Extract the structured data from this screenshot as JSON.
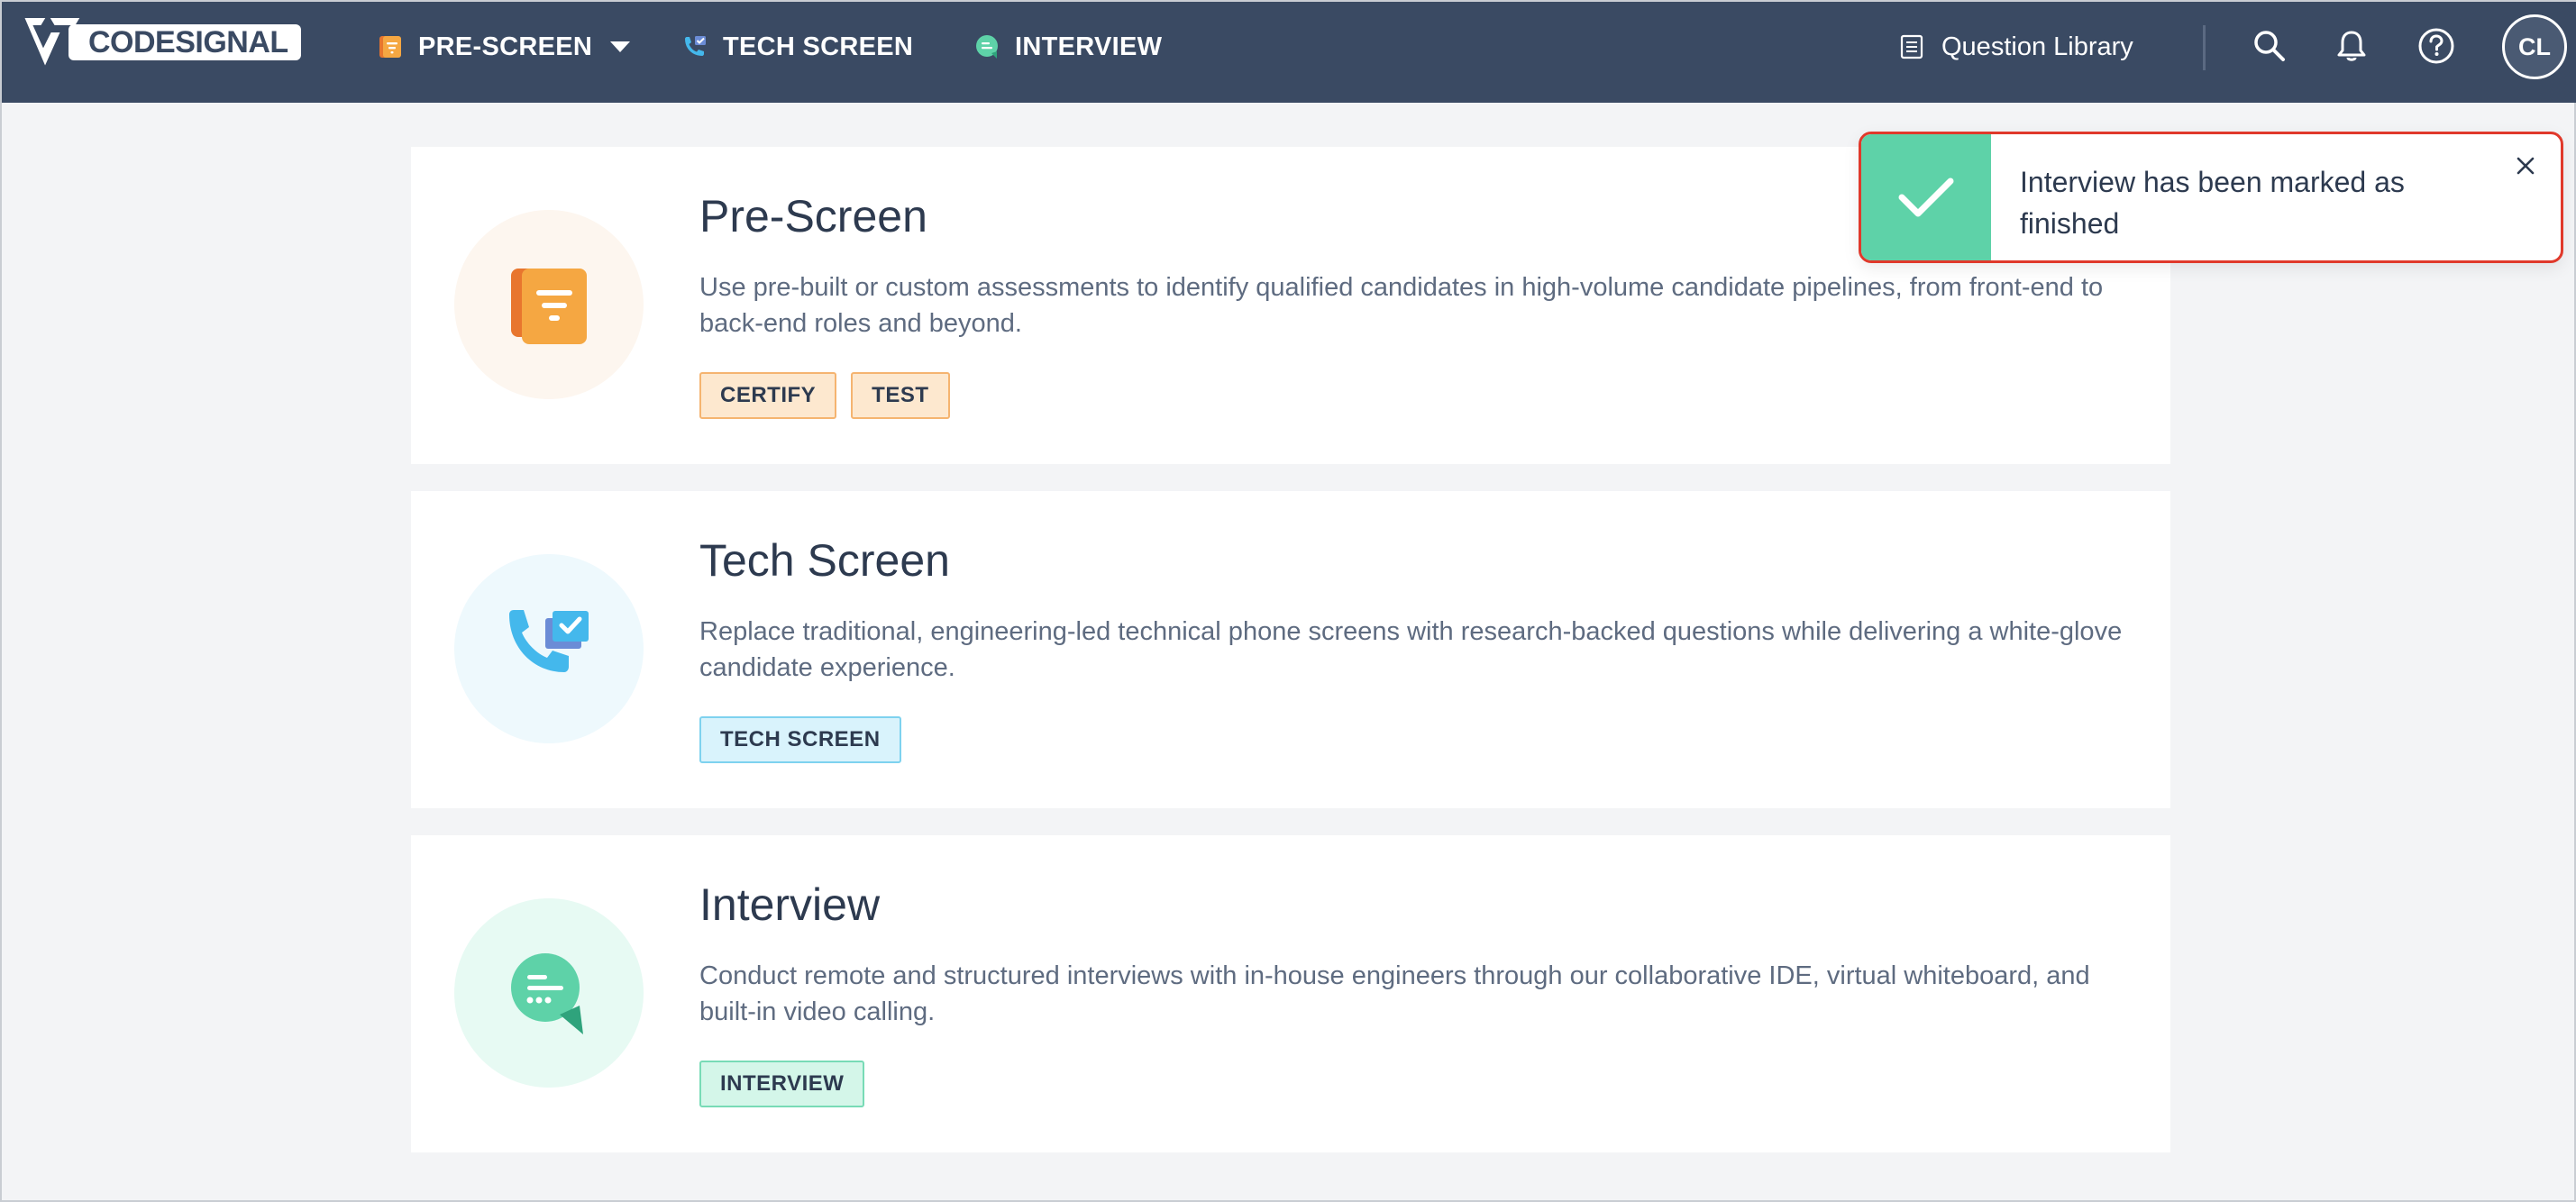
{
  "app": {
    "logo_text": "CODESIGNAL"
  },
  "nav": {
    "items": [
      {
        "label": "PRE-SCREEN",
        "icon": "prescreen-doc-icon",
        "has_dropdown": true
      },
      {
        "label": "TECH SCREEN",
        "icon": "phone-check-icon"
      },
      {
        "label": "INTERVIEW",
        "icon": "chat-bubble-icon"
      }
    ],
    "question_library": "Question Library",
    "avatar_initials": "CL"
  },
  "cards": [
    {
      "title": "Pre-Screen",
      "description": "Use pre-built or custom assessments to identify qualified candidates in high-volume candidate pipelines, from front-end to back-end roles and beyond.",
      "badges": [
        "CERTIFY",
        "TEST"
      ],
      "icon": "document-icon"
    },
    {
      "title": "Tech Screen",
      "description": "Replace traditional, engineering-led technical phone screens with research-backed questions while delivering a white-glove candidate experience.",
      "badges": [
        "TECH SCREEN"
      ],
      "icon": "phone-check-icon"
    },
    {
      "title": "Interview",
      "description": "Conduct remote and structured interviews with in-house engineers through our collaborative IDE, virtual whiteboard, and built-in video calling.",
      "badges": [
        "INTERVIEW"
      ],
      "icon": "chat-bubble-icon"
    }
  ],
  "toast": {
    "message": "Interview has been marked as finished",
    "status": "success"
  },
  "colors": {
    "topbar": "#3a4a63",
    "orange_accent": "#f5a742",
    "blue_accent": "#44b8ec",
    "green_accent": "#5ed2a8",
    "toast_border": "#e0392b"
  }
}
